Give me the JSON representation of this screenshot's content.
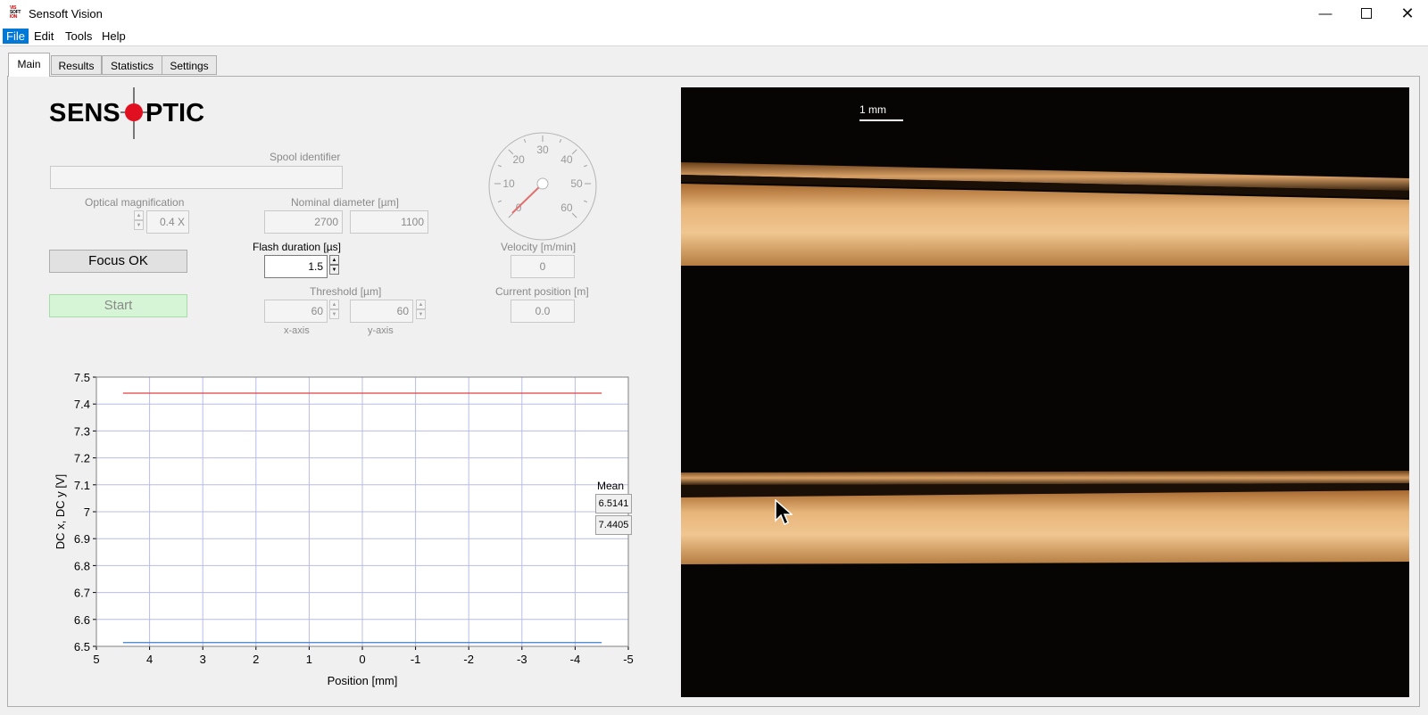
{
  "window": {
    "title": "Sensoft Vision",
    "icon_text": "VIS\nSOFT\nION"
  },
  "menubar": {
    "items": [
      "File",
      "Edit",
      "Tools",
      "Help"
    ]
  },
  "tabs": [
    "Main",
    "Results",
    "Statistics",
    "Settings"
  ],
  "logo": {
    "text": "SENSOPTIC"
  },
  "spool": {
    "label": "Spool identifier",
    "value": ""
  },
  "magnification": {
    "label": "Optical magnification",
    "value": "0.4 X"
  },
  "nominal_diameter": {
    "label": "Nominal diameter [µm]",
    "x": "2700",
    "y": "1100"
  },
  "flash": {
    "label": "Flash duration [µs]",
    "value": "1.5"
  },
  "threshold": {
    "label": "Threshold [µm]",
    "x": "60",
    "y": "60",
    "x_caption": "x-axis",
    "y_caption": "y-axis"
  },
  "gauge": {
    "ticks": [
      "0",
      "10",
      "20",
      "30",
      "40",
      "50",
      "60"
    ],
    "value": 0
  },
  "velocity": {
    "label": "Velocity [m/min]",
    "value": "0"
  },
  "position": {
    "label": "Current position [m]",
    "value": "0.0"
  },
  "buttons": {
    "focus": "Focus OK",
    "start": "Start"
  },
  "mean": {
    "label": "Mean",
    "values": [
      "6.5141",
      "7.4405"
    ]
  },
  "camera": {
    "scale_label": "1 mm"
  },
  "chart_data": {
    "type": "line",
    "xlabel": "Position [mm]",
    "ylabel": "DC x, DC y [V]",
    "xlim": [
      5,
      -5
    ],
    "ylim": [
      6.5,
      7.5
    ],
    "x_ticks": [
      "5",
      "4",
      "3",
      "2",
      "1",
      "0",
      "-1",
      "-2",
      "-3",
      "-4",
      "-5"
    ],
    "y_ticks": [
      "7.5",
      "7.4",
      "7.3",
      "7.2",
      "7.1",
      "7",
      "6.9",
      "6.8",
      "6.7",
      "6.6",
      "6.5"
    ],
    "grid": true,
    "series": [
      {
        "color": "#e04040",
        "x": [
          4.5,
          -4.5
        ],
        "y": [
          7.4405,
          7.4405
        ]
      },
      {
        "color": "#3c7fd0",
        "x": [
          4.5,
          -4.5
        ],
        "y": [
          6.5141,
          6.5141
        ]
      }
    ]
  }
}
